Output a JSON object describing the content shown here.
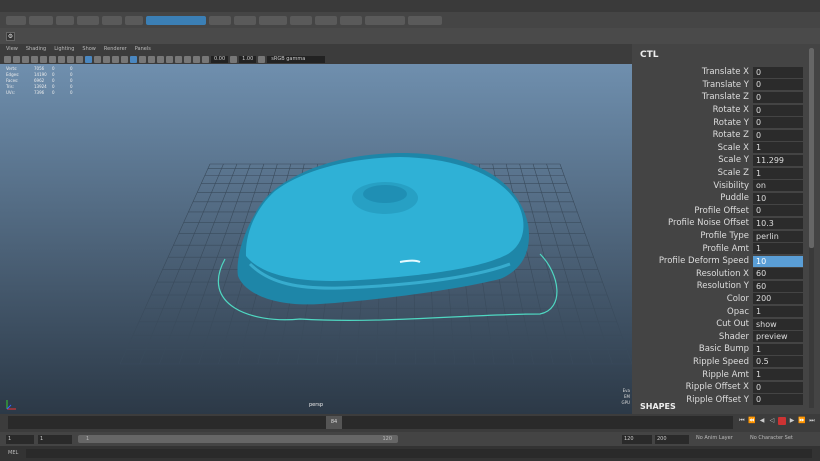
{
  "app": {
    "menus": [
      "",
      "",
      "",
      "",
      "",
      "",
      "",
      "",
      "",
      "",
      "",
      "",
      "",
      ""
    ]
  },
  "panel": {
    "menus": [
      "View",
      "Shading",
      "Lighting",
      "Show",
      "Renderer",
      "Panels"
    ],
    "toolbar": {
      "value_a": "0.00",
      "value_b": "1.00",
      "color_space": "sRGB gamma"
    }
  },
  "hud": {
    "rows": [
      {
        "label": "Verts:",
        "v1": "7056",
        "v2": "0",
        "v3": "0"
      },
      {
        "label": "Edges:",
        "v1": "14190",
        "v2": "0",
        "v3": "0"
      },
      {
        "label": "Faces:",
        "v1": "6962",
        "v2": "0",
        "v3": "0"
      },
      {
        "label": "Tris:",
        "v1": "13924",
        "v2": "0",
        "v3": "0"
      },
      {
        "label": "UVs:",
        "v1": "7396",
        "v2": "0",
        "v3": "0"
      }
    ]
  },
  "viewport": {
    "camera": "persp",
    "fps_lines": [
      "Eva",
      "EM",
      "GPU"
    ]
  },
  "attributes": {
    "node": "CTL",
    "items": [
      {
        "label": "Translate X",
        "value": "0"
      },
      {
        "label": "Translate Y",
        "value": "0"
      },
      {
        "label": "Translate Z",
        "value": "0"
      },
      {
        "label": "Rotate X",
        "value": "0"
      },
      {
        "label": "Rotate Y",
        "value": "0"
      },
      {
        "label": "Rotate Z",
        "value": "0"
      },
      {
        "label": "Scale X",
        "value": "1"
      },
      {
        "label": "Scale Y",
        "value": "11.299"
      },
      {
        "label": "Scale Z",
        "value": "1"
      },
      {
        "label": "Visibility",
        "value": "on"
      },
      {
        "label": "Puddle",
        "value": "10"
      },
      {
        "label": "Profile Offset",
        "value": "0"
      },
      {
        "label": "Profile Noise Offset",
        "value": "10.3"
      },
      {
        "label": "Profile Type",
        "value": "perlin"
      },
      {
        "label": "Profile Amt",
        "value": "1"
      },
      {
        "label": "Profile Deform Speed",
        "value": "10"
      },
      {
        "label": "Resolution X",
        "value": "60"
      },
      {
        "label": "Resolution Y",
        "value": "60"
      },
      {
        "label": "Color",
        "value": "200"
      },
      {
        "label": "Opac",
        "value": "1"
      },
      {
        "label": "Cut Out",
        "value": "show"
      },
      {
        "label": "Shader",
        "value": "preview"
      },
      {
        "label": "Basic Bump",
        "value": "1"
      },
      {
        "label": "Ripple Speed",
        "value": "0.5"
      },
      {
        "label": "Ripple Amt",
        "value": "1"
      },
      {
        "label": "Ripple Offset X",
        "value": "0"
      },
      {
        "label": "Ripple Offset Y",
        "value": "0"
      }
    ],
    "highlighted_index": 15,
    "shapes_label": "SHAPES"
  },
  "timeline": {
    "current_frame": "84",
    "start": "1",
    "start_b": "1",
    "range_start": "1",
    "range_end": "120",
    "end": "120",
    "end_b": "200",
    "anim_layer": "No Anim Layer",
    "char_set": "No Character Set"
  },
  "command": {
    "mode": "MEL"
  },
  "colors": {
    "mesh": "#2fb1d6",
    "highlight": "#5a9ed6",
    "curve": "#4fd8c2"
  }
}
